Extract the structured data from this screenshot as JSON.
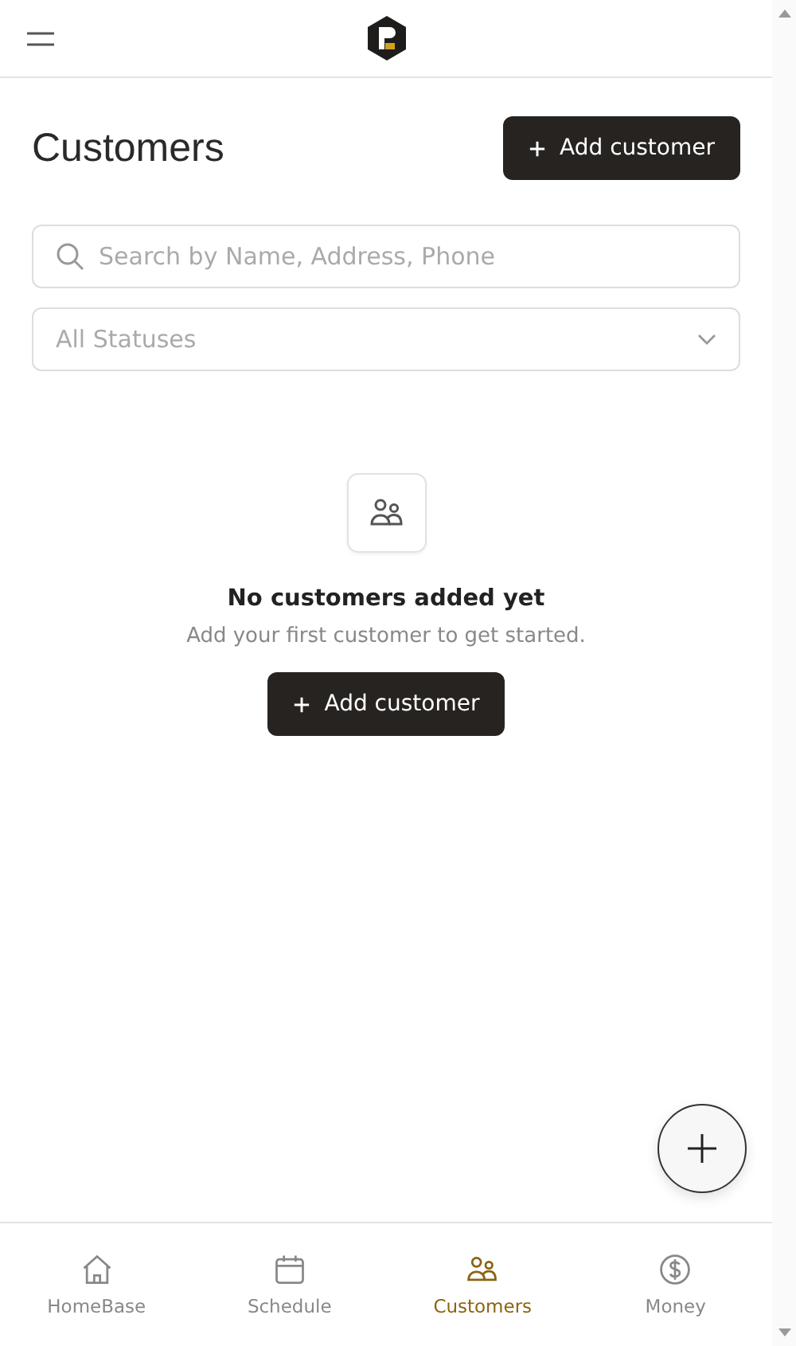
{
  "header": {
    "title": "Customers",
    "add_button": "Add customer"
  },
  "search": {
    "placeholder": "Search by Name, Address, Phone"
  },
  "status_filter": {
    "placeholder": "All Statuses"
  },
  "empty_state": {
    "heading": "No customers added yet",
    "message": "Add your first customer to get started.",
    "button": "Add customer"
  },
  "bottom_nav": [
    {
      "label": "HomeBase",
      "kind": "home",
      "selected": false
    },
    {
      "label": "Schedule",
      "kind": "calendar",
      "selected": false
    },
    {
      "label": "Customers",
      "kind": "people",
      "selected": true
    },
    {
      "label": "Money",
      "kind": "dollar",
      "selected": false
    }
  ]
}
